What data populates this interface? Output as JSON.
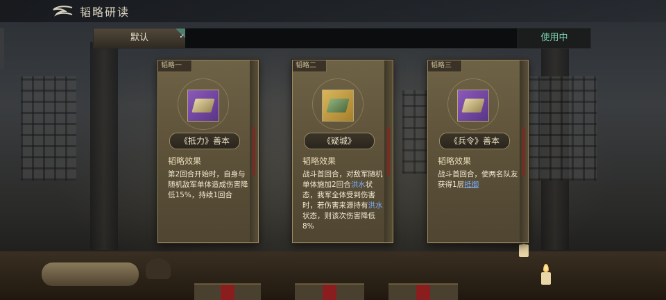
{
  "header": {
    "back_icon": "back-arrow-icon",
    "title": "韬略研读"
  },
  "tabs": {
    "default_label": "默认",
    "default_selected": true,
    "in_use_label": "使用中"
  },
  "cards": [
    {
      "tag": "韬略一",
      "icon": "scroll-icon",
      "icon_bg": "#7a4fb0",
      "name": "《抵力》善本",
      "effect_label": "韬略效果",
      "desc": "第2回合开始时，自身与随机敌军单体造成伤害降低15%，持续1回合"
    },
    {
      "tag": "韬略二",
      "icon": "book-icon",
      "icon_bg": "#c9a64a",
      "name": "《疑城》",
      "effect_label": "韬略效果",
      "desc_parts": [
        "战斗首回合，对敌军随机单体施加2回合",
        "洪水",
        "状态，我军全体受到伤害时，若伤害来源持有",
        "洪水",
        "状态，则该次伤害降低8%"
      ]
    },
    {
      "tag": "韬略三",
      "icon": "scroll-icon",
      "icon_bg": "#7a4fb0",
      "name": "《兵令》善本",
      "effect_label": "韬略效果",
      "desc_parts": [
        "战斗首回合，使两名队友获得1层",
        "抵御"
      ]
    }
  ],
  "colors": {
    "in_use_text": "#7fd3b2",
    "keyword": "#7fb0ff",
    "card_bg": "#5b5038"
  }
}
